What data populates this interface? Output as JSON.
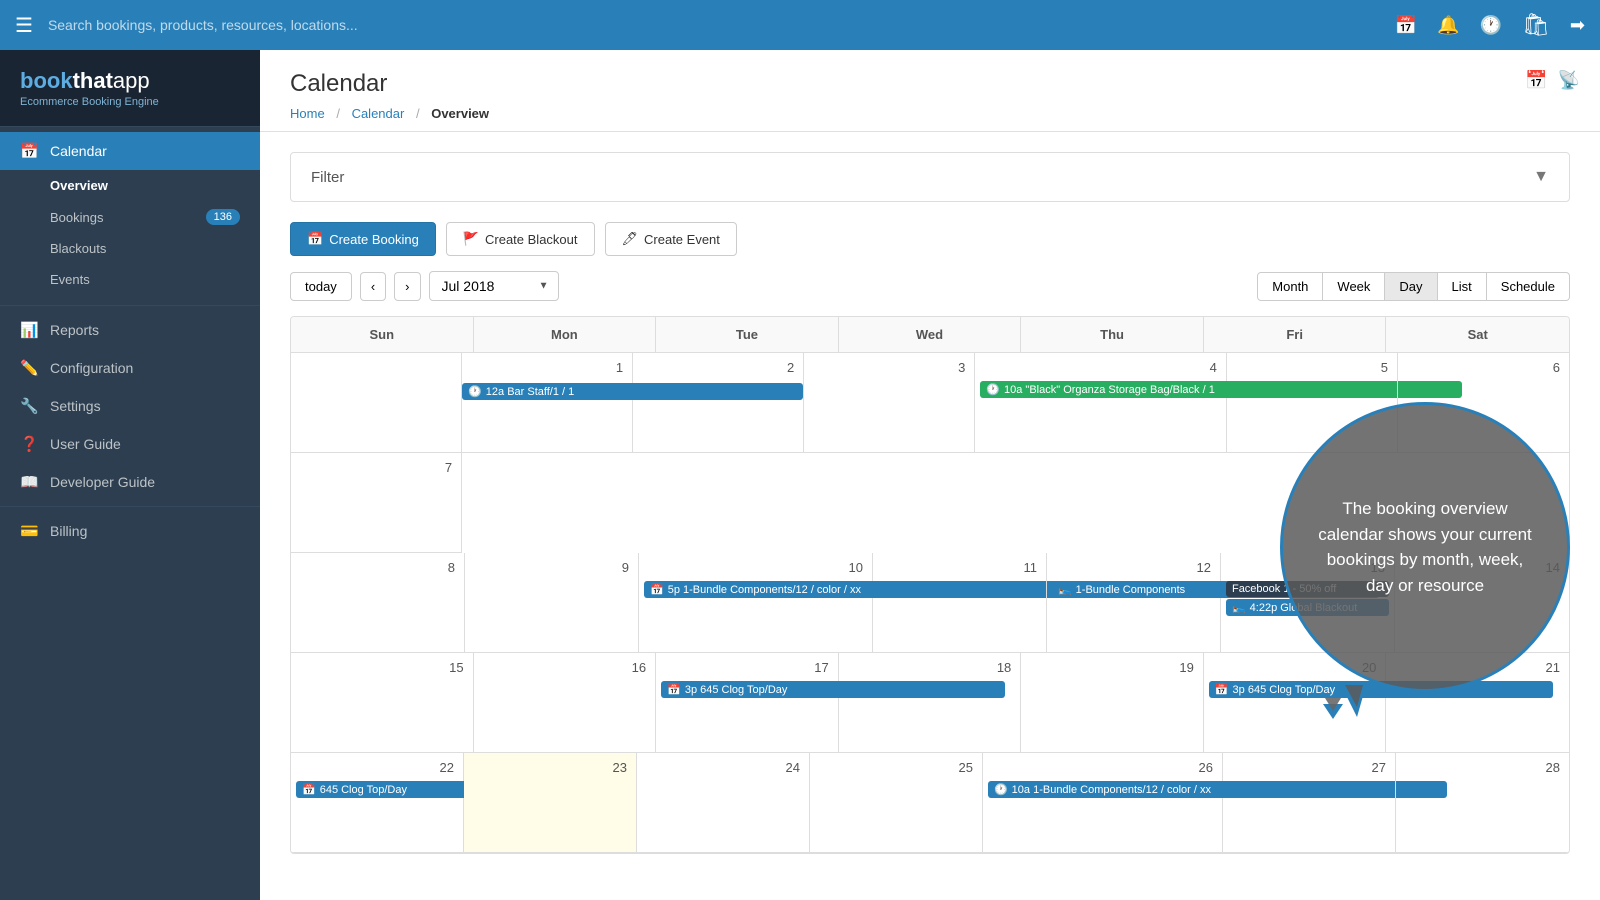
{
  "topnav": {
    "search_placeholder": "Search bookings, products, resources, locations...",
    "icons": [
      "calendar-icon",
      "bell-icon",
      "clock-icon",
      "shopify-icon",
      "logout-icon"
    ]
  },
  "sidebar": {
    "logo": {
      "brand": "bookthatapp",
      "sub": "Ecommerce Booking Engine"
    },
    "items": [
      {
        "label": "Calendar",
        "icon": "📅",
        "active": true
      },
      {
        "label": "Overview",
        "sub": true,
        "active": true
      },
      {
        "label": "Bookings",
        "sub": true,
        "badge": "136"
      },
      {
        "label": "Blackouts",
        "sub": true
      },
      {
        "label": "Events",
        "sub": true
      },
      {
        "label": "Reports",
        "icon": "📊"
      },
      {
        "label": "Configuration",
        "icon": "⚙️"
      },
      {
        "label": "Settings",
        "icon": "🔧"
      },
      {
        "label": "User Guide",
        "icon": "❓"
      },
      {
        "label": "Developer Guide",
        "icon": "📖"
      },
      {
        "label": "Billing",
        "icon": "💳"
      }
    ]
  },
  "page": {
    "title": "Calendar",
    "breadcrumb": {
      "home": "Home",
      "calendar": "Calendar",
      "current": "Overview"
    }
  },
  "filter": {
    "label": "Filter"
  },
  "toolbar": {
    "create_booking": "Create Booking",
    "create_blackout": "Create Blackout",
    "create_event": "Create Event"
  },
  "calendar_nav": {
    "today": "today",
    "month": "Jul 2018",
    "views": [
      "Month",
      "Week",
      "Day",
      "List",
      "Schedule"
    ]
  },
  "calendar": {
    "days": [
      "Sun",
      "Mon",
      "Tue",
      "Wed",
      "Thu",
      "Fri",
      "Sat"
    ],
    "tooltip": "The booking overview calendar shows your current bookings by month, week, day or resource",
    "weeks": [
      {
        "cells": [
          {
            "day": "",
            "events": []
          },
          {
            "day": "1",
            "events": []
          },
          {
            "day": "2",
            "events": []
          },
          {
            "day": "3",
            "events": []
          },
          {
            "day": "4",
            "events": [
              {
                "label": "10a \"Black\" Organza Storage Bag/Black / 1",
                "color": "event-green",
                "icon": "🕐"
              }
            ]
          },
          {
            "day": "5",
            "events": []
          },
          {
            "day": "6",
            "events": []
          },
          {
            "day": "7",
            "events": []
          }
        ]
      },
      {
        "cells": [
          {
            "day": "1",
            "events": [
              {
                "label": "12a Bar Staff/1 / 1",
                "color": "event-blue",
                "icon": "🕐",
                "span": true
              }
            ]
          },
          {
            "day": "2",
            "events": []
          },
          {
            "day": "8",
            "events": []
          },
          {
            "day": "9",
            "events": []
          },
          {
            "day": "10",
            "events": [
              {
                "label": "5p 1-Bundle Components/12 / color / xx",
                "color": "event-blue",
                "icon": "📅",
                "span": true
              }
            ]
          },
          {
            "day": "11",
            "events": []
          },
          {
            "day": "12",
            "events": [
              {
                "label": "1-Bundle Components",
                "color": "event-blue",
                "icon": "🛌",
                "span": true
              }
            ]
          },
          {
            "day": "13",
            "events": [
              {
                "label": "Facebook 1 - 50% off",
                "color": "event-dark"
              },
              {
                "label": "4:22p Global Blackout",
                "color": "event-blue",
                "icon": "🛌"
              }
            ]
          },
          {
            "day": "14",
            "events": []
          }
        ]
      },
      {
        "cells": [
          {
            "day": "15",
            "events": []
          },
          {
            "day": "16",
            "events": []
          },
          {
            "day": "17",
            "events": [
              {
                "label": "3p 645 Clog Top/Day",
                "color": "event-blue",
                "icon": "📅",
                "span": true
              }
            ]
          },
          {
            "day": "18",
            "events": []
          },
          {
            "day": "19",
            "events": []
          },
          {
            "day": "20",
            "events": [
              {
                "label": "3p 645 Clog Top/Day",
                "color": "event-blue",
                "icon": "📅",
                "span": true
              }
            ]
          },
          {
            "day": "21",
            "events": []
          }
        ]
      },
      {
        "cells": [
          {
            "day": "22",
            "events": [
              {
                "label": "645 Clog Top/Day",
                "color": "event-blue",
                "icon": "📅",
                "span": true
              }
            ]
          },
          {
            "day": "23",
            "events": [],
            "today": true
          },
          {
            "day": "24",
            "events": []
          },
          {
            "day": "25",
            "events": []
          },
          {
            "day": "26",
            "events": [
              {
                "label": "10a 1-Bundle Components/12 / color / xx",
                "color": "event-blue",
                "icon": "🕐",
                "span": true
              }
            ]
          },
          {
            "day": "27",
            "events": []
          },
          {
            "day": "28",
            "events": []
          }
        ]
      }
    ]
  }
}
